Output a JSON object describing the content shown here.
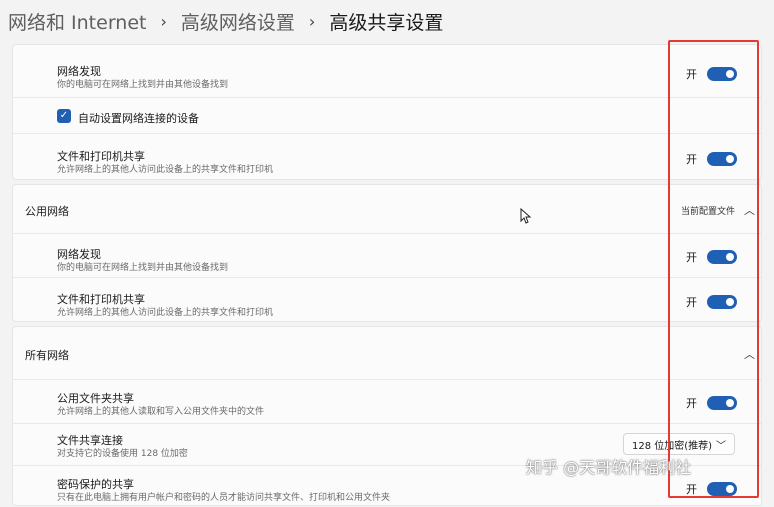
{
  "breadcrumb": {
    "items": [
      "网络和 Internet",
      "高级网络设置",
      "高级共享设置"
    ],
    "separator": "›"
  },
  "private_section": {
    "network_discovery": {
      "title": "网络发现",
      "desc": "你的电脑可在网络上找到并由其他设备找到",
      "state": "开"
    },
    "auto_setup": {
      "label": "自动设置网络连接的设备",
      "checked": true
    },
    "file_printer_sharing": {
      "title": "文件和打印机共享",
      "desc": "允许网络上的其他人访问此设备上的共享文件和打印机",
      "state": "开"
    }
  },
  "public_section": {
    "header": "公用网络",
    "current_profile": "当前配置文件",
    "network_discovery": {
      "title": "网络发现",
      "desc": "你的电脑可在网络上找到并由其他设备找到",
      "state": "开"
    },
    "file_printer_sharing": {
      "title": "文件和打印机共享",
      "desc": "允许网络上的其他人访问此设备上的共享文件和打印机",
      "state": "开"
    }
  },
  "all_section": {
    "header": "所有网络",
    "public_folder_sharing": {
      "title": "公用文件夹共享",
      "desc": "允许网络上的其他人读取和写入公用文件夹中的文件",
      "state": "开"
    },
    "file_sharing_connection": {
      "title": "文件共享连接",
      "desc": "对支持它的设备使用 128 位加密",
      "selected": "128 位加密(推荐)"
    },
    "password_protected": {
      "title": "密码保护的共享",
      "desc": "只有在此电脑上拥有用户帐户和密码的人员才能访问共享文件、打印机和公用文件夹",
      "state": "开"
    }
  },
  "icons": {
    "chevron_up": "chevron-up-icon",
    "chevron_down": "chevron-down-icon",
    "check": "check-icon",
    "cursor": "cursor-icon"
  },
  "colors": {
    "accent": "#1f5fb4",
    "highlight": "#e53935"
  },
  "watermark": "知乎 @天哥软件福利社"
}
